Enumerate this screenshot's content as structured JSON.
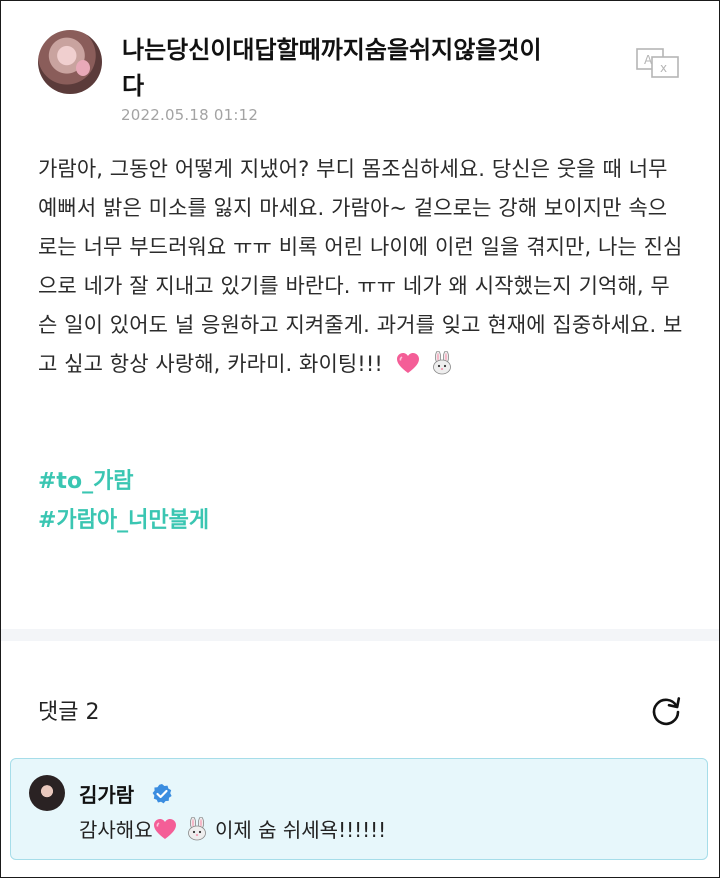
{
  "post": {
    "title": "나는당신이대답할때까지숨을쉬지않을것이다",
    "date": "2022.05.18 01:12",
    "body": "가람아, 그동안 어떻게 지냈어? 부디 몸조심하세요. 당신은 웃을 때 너무 예뻐서 밝은 미소를 잃지 마세요. 가람아~ 겉으로는 강해 보이지만 속으로는 너무 부드러워요 ㅠㅠ 비록 어린 나이에 이런 일을 겪지만, 나는 진심으로 네가 잘 지내고 있기를 바란다. ㅠㅠ 네가 왜 시작했는지 기억해, 무슨 일이 있어도 널 응원하고 지켜줄게. 과거를 잊고 현재에 집중하세요. 보고 싶고 항상 사랑해, 카라미. 화이팅!!!",
    "hashtags": [
      "#to_가람",
      "#가람아_너만볼게"
    ],
    "icons": {
      "translate": "translate-icon",
      "heart": "pink-heart-emoji",
      "rabbit": "rabbit-emoji"
    }
  },
  "comments": {
    "label": "댓글 2",
    "refresh_icon": "refresh-icon",
    "items": [
      {
        "author": "김가람",
        "verified_icon": "verified-badge-icon",
        "text_before": "감사해요",
        "text_after": "이제 숨 쉬세욕!!!!!!"
      }
    ]
  },
  "colors": {
    "hashtag": "#3ac6b2",
    "date": "#a3a3a3",
    "comment_bg": "#e7f7fb",
    "comment_border": "#a6dde9",
    "verified": "#3b8de0"
  }
}
